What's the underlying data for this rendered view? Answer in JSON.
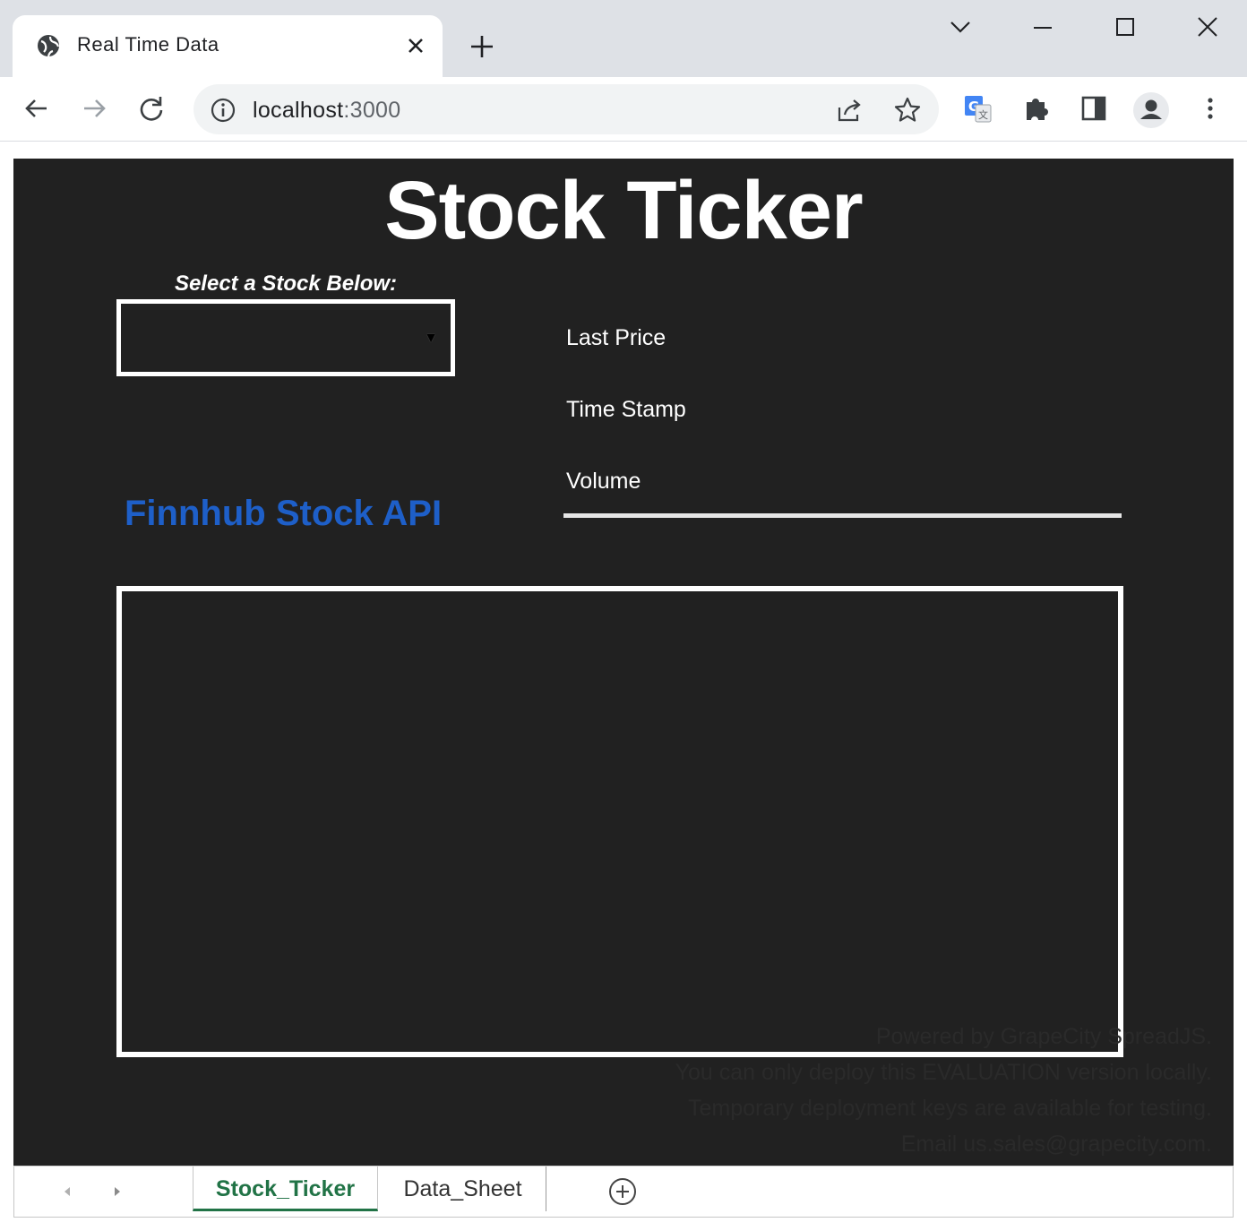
{
  "browser": {
    "tab_title": "Real Time Data",
    "url_host": "localhost",
    "url_port": ":3000",
    "icons": [
      "globe-icon",
      "close-icon",
      "plus-icon",
      "chevron-down-icon",
      "minimize-icon",
      "maximize-icon",
      "window-close-icon",
      "back-arrow-icon",
      "forward-arrow-icon",
      "reload-icon",
      "info-icon",
      "share-icon",
      "star-icon",
      "translate-icon",
      "puzzle-icon",
      "side-panel-icon",
      "profile-icon",
      "more-vert-icon"
    ]
  },
  "sheet": {
    "title": "Stock Ticker",
    "select_label": "Select a Stock Below:",
    "selected_stock": "",
    "api_label": "Finnhub Stock API",
    "fields": {
      "last_price": "Last Price",
      "time_stamp": "Time Stamp",
      "volume": "Volume"
    },
    "watermark": [
      "Powered by GrapeCity SpreadJS.",
      "You can only deploy this EVALUATION version locally.",
      "Temporary deployment keys are available for testing.",
      "Email us.sales@grapecity.com."
    ],
    "colors": {
      "background": "#212121",
      "api_label": "#1e5fc8",
      "active_tab": "#217346"
    }
  },
  "tabs": {
    "active": "Stock_Ticker",
    "other": "Data_Sheet"
  }
}
